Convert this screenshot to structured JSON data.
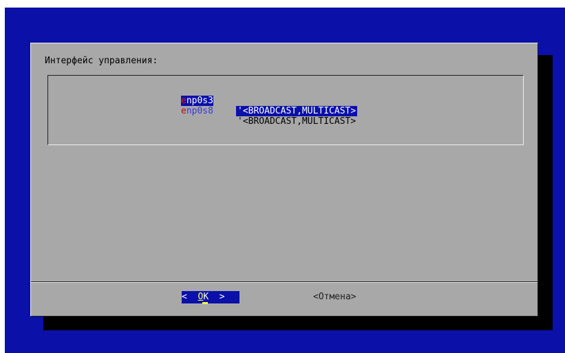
{
  "dialog": {
    "title": "Интерфейс управления:"
  },
  "interfaces": [
    {
      "first": "e",
      "rest": "np0s3",
      "description": "'<BROADCAST,MULTICAST>",
      "selected": true
    },
    {
      "first": "e",
      "rest": "np0s8",
      "description": "'<BROADCAST,MULTICAST>",
      "selected": false
    }
  ],
  "buttons": {
    "ok_left": "<  ",
    "ok_hot": "O",
    "ok_rest": "K  >",
    "cancel": "<Отмена>"
  },
  "colors": {
    "screen_bg": "#0a10a8",
    "dialog_bg": "#a8a8a8",
    "selection_bg": "#0a10a8"
  }
}
